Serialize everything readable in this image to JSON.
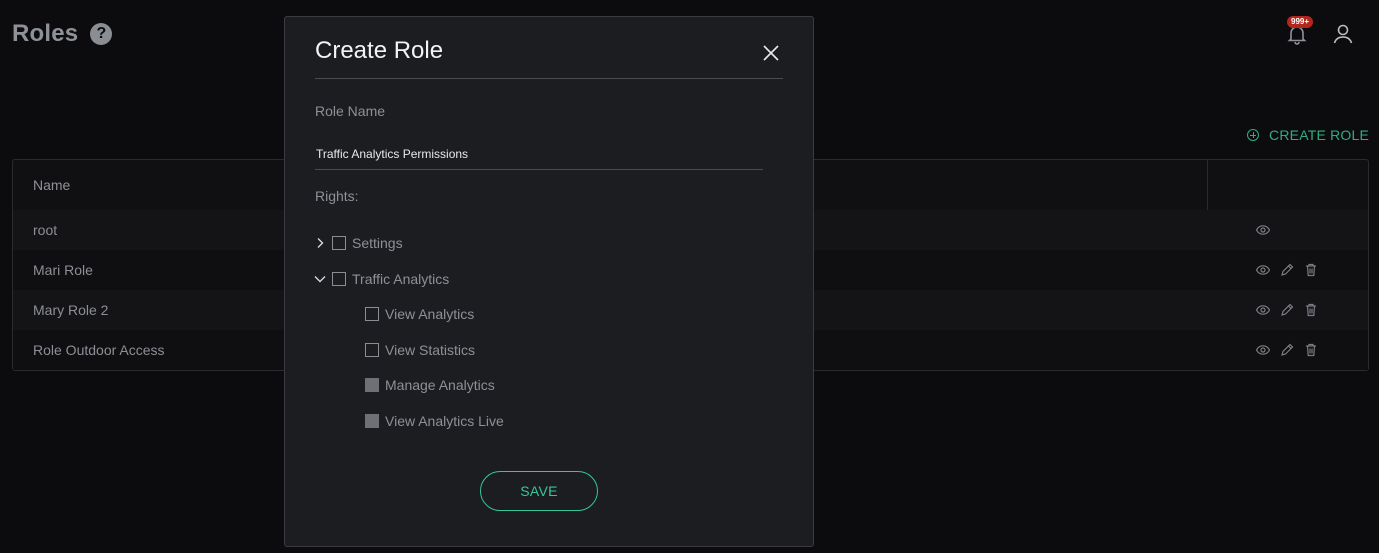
{
  "page": {
    "title": "Roles",
    "help_glyph": "?",
    "notification_badge": "999+",
    "create_role_label": "CREATE ROLE"
  },
  "table": {
    "columns": [
      "Name"
    ],
    "rows": [
      {
        "name": "root",
        "actions": [
          "view"
        ]
      },
      {
        "name": "Mari Role",
        "actions": [
          "view",
          "edit",
          "delete"
        ]
      },
      {
        "name": "Mary Role 2",
        "actions": [
          "view",
          "edit",
          "delete"
        ]
      },
      {
        "name": "Role Outdoor Access",
        "actions": [
          "view",
          "edit",
          "delete"
        ]
      }
    ]
  },
  "modal": {
    "title": "Create Role",
    "role_name_label": "Role Name",
    "role_name_value": "Traffic Analytics Permissions",
    "rights_label": "Rights:",
    "rights": [
      {
        "label": "Settings",
        "expanded": false,
        "checked": false
      },
      {
        "label": "Traffic Analytics",
        "expanded": true,
        "checked": false,
        "children": [
          {
            "label": "View Analytics",
            "checked": false,
            "disabled": false
          },
          {
            "label": "View Statistics",
            "checked": false,
            "disabled": false
          },
          {
            "label": "Manage Analytics",
            "checked": false,
            "disabled": true
          },
          {
            "label": "View Analytics Live",
            "checked": false,
            "disabled": true
          }
        ]
      }
    ],
    "save_label": "SAVE"
  },
  "colors": {
    "accent": "#35c79a",
    "link": "#2fae7f",
    "badge": "#b3261e",
    "modal_bg": "#1c1d21",
    "page_bg": "#0c0c0e"
  }
}
